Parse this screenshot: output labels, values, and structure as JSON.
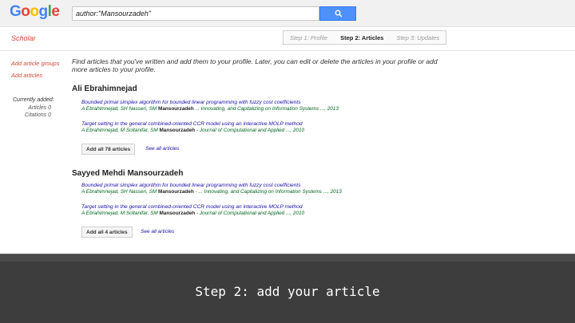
{
  "header": {
    "logo_letters": [
      {
        "char": "G",
        "color": "#4285f4"
      },
      {
        "char": "o",
        "color": "#ea4335"
      },
      {
        "char": "o",
        "color": "#fbbc05"
      },
      {
        "char": "g",
        "color": "#4285f4"
      },
      {
        "char": "l",
        "color": "#34a853"
      },
      {
        "char": "e",
        "color": "#ea4335"
      }
    ],
    "search_query": "author:\"Mansourzadeh\"",
    "search_icon": "search-icon"
  },
  "subbar": {
    "scholar_label": "Scholar",
    "steps": [
      {
        "label": "Step 1: Profile",
        "active": false
      },
      {
        "label": "Step 2: Articles",
        "active": true
      },
      {
        "label": "Step 3: Updates",
        "active": false
      }
    ]
  },
  "sidebar": {
    "links": [
      "Add article groups",
      "Add articles"
    ],
    "stats_title": "Currently added:",
    "stats": [
      "Articles   0",
      "Citations   0"
    ]
  },
  "main": {
    "intro": "Find articles that you've written and add them to your profile. Later, you can edit or delete the articles in your profile or add more articles to your profile.",
    "authors": [
      {
        "name": "Ali Ebrahimnejad",
        "articles": [
          {
            "title": "Bounded primal simplex algorithm for bounded linear programming with fuzzy cost coefficients",
            "authors": "A Ebrahimnejad, SH Nasseri, SM ",
            "highlight": "Mansourzadeh",
            "venue": " ... Innovating, and Capitalizing on Information Systems ..., 2013"
          },
          {
            "title": "Target setting in the general combined-oriented CCR model using an interactive MOLP method",
            "authors": "A Ebrahimnejad, M Soltanifar, SM ",
            "highlight": "Mansourzadeh",
            "venue": " - Journal of Computational and Applied ..., 2010"
          }
        ],
        "add_label": "Add all 78 articles",
        "see_label": "See all articles"
      },
      {
        "name": "Sayyed Mehdi Mansourzadeh",
        "articles": [
          {
            "title": "Bounded primal simplex algorithm for bounded linear programming with fuzzy cost coefficients",
            "authors": "A Ebrahimnejad, SH Nasseri, SM ",
            "highlight": "Mansourzadeh",
            "venue": " - ... Innovating, and Capitalizing on Information Systems ..., 2013"
          },
          {
            "title": "Target setting in the general combined-oriented CCR model using an interactive MOLP method",
            "authors": "A Ebrahimnejad, M Soltanifar, SM ",
            "highlight": "Mansourzadeh",
            "venue": " - Journal of Computational and Applied ..., 2010"
          }
        ],
        "add_label": "Add all 4 articles",
        "see_label": "See all articles"
      }
    ]
  },
  "caption": "Step 2: add your article"
}
